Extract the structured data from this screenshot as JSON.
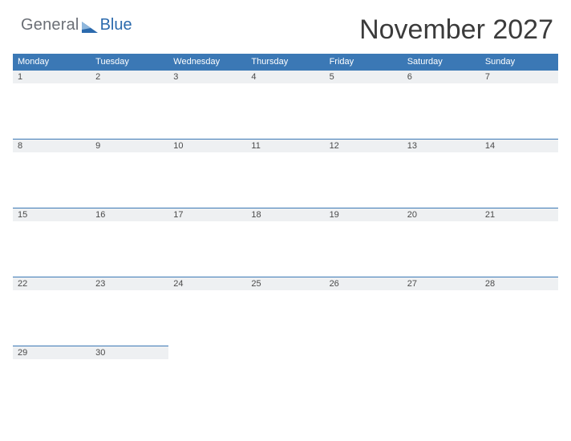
{
  "brand": {
    "word1": "General",
    "word2": "Blue"
  },
  "title": "November 2027",
  "day_names": [
    "Monday",
    "Tuesday",
    "Wednesday",
    "Thursday",
    "Friday",
    "Saturday",
    "Sunday"
  ],
  "weeks": [
    {
      "days": [
        "1",
        "2",
        "3",
        "4",
        "5",
        "6",
        "7"
      ]
    },
    {
      "days": [
        "8",
        "9",
        "10",
        "11",
        "12",
        "13",
        "14"
      ]
    },
    {
      "days": [
        "15",
        "16",
        "17",
        "18",
        "19",
        "20",
        "21"
      ]
    },
    {
      "days": [
        "22",
        "23",
        "24",
        "25",
        "26",
        "27",
        "28"
      ]
    },
    {
      "days": [
        "29",
        "30",
        "",
        "",
        "",
        "",
        ""
      ]
    }
  ],
  "colors": {
    "accent": "#3b78b5",
    "band": "#eef0f2"
  }
}
